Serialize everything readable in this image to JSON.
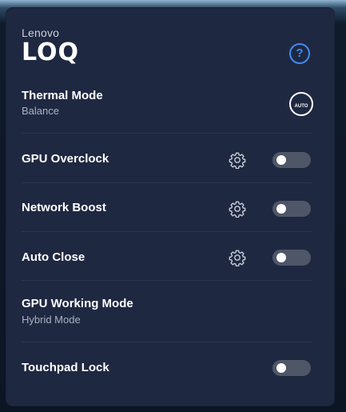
{
  "brand": {
    "vendor": "Lenovo",
    "product": "LOQ"
  },
  "help_label": "?",
  "thermal": {
    "title": "Thermal Mode",
    "value": "Balance",
    "icon": "auto-mode-icon",
    "icon_text": "AUTO"
  },
  "items": [
    {
      "title": "GPU Overclock",
      "has_settings": true,
      "toggle_on": false
    },
    {
      "title": "Network Boost",
      "has_settings": true,
      "toggle_on": false
    },
    {
      "title": "Auto Close",
      "has_settings": true,
      "toggle_on": false
    }
  ],
  "gpu_mode": {
    "title": "GPU Working Mode",
    "value": "Hybrid Mode"
  },
  "touchpad": {
    "title": "Touchpad Lock",
    "toggle_on": false
  },
  "colors": {
    "panel": "#1f2841",
    "accent": "#3d8df2",
    "toggle_off": "#4e5668",
    "divider": "#2a3550"
  }
}
